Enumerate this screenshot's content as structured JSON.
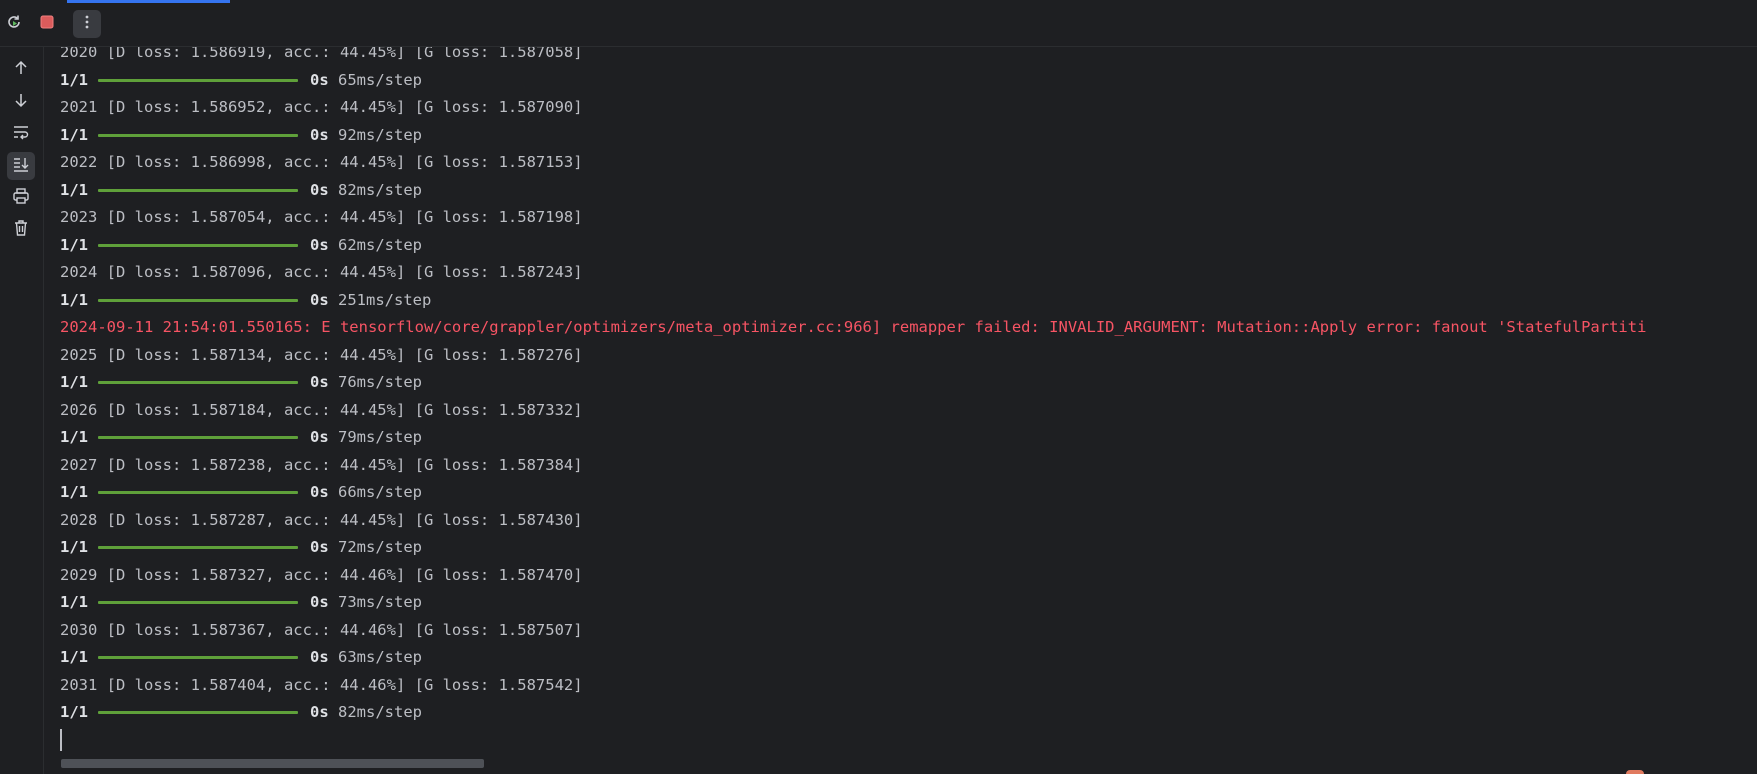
{
  "toolbar": {
    "rerun_icon": "rerun-icon",
    "stop_icon": "stop-icon",
    "more_icon": "more-vertical-icon"
  },
  "sidebar": {
    "items": [
      {
        "name": "scroll-up-icon"
      },
      {
        "name": "scroll-down-icon"
      },
      {
        "name": "soft-wrap-icon"
      },
      {
        "name": "scroll-to-end-icon"
      },
      {
        "name": "print-icon"
      },
      {
        "name": "clear-all-icon"
      }
    ]
  },
  "console": {
    "epochs": [
      {
        "epoch": "2020 [D loss: 1.586919, acc.: 44.45%] [G loss: 1.587058]",
        "progress": "1/1",
        "time_label": "0s",
        "step": "65ms/step",
        "fraction": 1.0
      },
      {
        "epoch": "2021 [D loss: 1.586952, acc.: 44.45%] [G loss: 1.587090]",
        "progress": "1/1",
        "time_label": "0s",
        "step": "92ms/step",
        "fraction": 1.0
      },
      {
        "epoch": "2022 [D loss: 1.586998, acc.: 44.45%] [G loss: 1.587153]",
        "progress": "1/1",
        "time_label": "0s",
        "step": "82ms/step",
        "fraction": 1.0
      },
      {
        "epoch": "2023 [D loss: 1.587054, acc.: 44.45%] [G loss: 1.587198]",
        "progress": "1/1",
        "time_label": "0s",
        "step": "62ms/step",
        "fraction": 1.0
      },
      {
        "epoch": "2024 [D loss: 1.587096, acc.: 44.45%] [G loss: 1.587243]",
        "progress": "1/1",
        "time_label": "0s",
        "step": "251ms/step",
        "fraction": 1.0
      }
    ],
    "error_line": "2024-09-11 21:54:01.550165: E tensorflow/core/grappler/optimizers/meta_optimizer.cc:966] remapper failed: INVALID_ARGUMENT: Mutation::Apply error: fanout 'StatefulPartiti",
    "epochs_after": [
      {
        "epoch": "2025 [D loss: 1.587134, acc.: 44.45%] [G loss: 1.587276]",
        "progress": "1/1",
        "time_label": "0s",
        "step": "76ms/step",
        "fraction": 1.0
      },
      {
        "epoch": "2026 [D loss: 1.587184, acc.: 44.45%] [G loss: 1.587332]",
        "progress": "1/1",
        "time_label": "0s",
        "step": "79ms/step",
        "fraction": 1.0
      },
      {
        "epoch": "2027 [D loss: 1.587238, acc.: 44.45%] [G loss: 1.587384]",
        "progress": "1/1",
        "time_label": "0s",
        "step": "66ms/step",
        "fraction": 1.0
      },
      {
        "epoch": "2028 [D loss: 1.587287, acc.: 44.45%] [G loss: 1.587430]",
        "progress": "1/1",
        "time_label": "0s",
        "step": "72ms/step",
        "fraction": 1.0
      },
      {
        "epoch": "2029 [D loss: 1.587327, acc.: 44.46%] [G loss: 1.587470]",
        "progress": "1/1",
        "time_label": "0s",
        "step": "73ms/step",
        "fraction": 1.0
      },
      {
        "epoch": "2030 [D loss: 1.587367, acc.: 44.46%] [G loss: 1.587507]",
        "progress": "1/1",
        "time_label": "0s",
        "step": "63ms/step",
        "fraction": 1.0
      },
      {
        "epoch": "2031 [D loss: 1.587404, acc.: 44.46%] [G loss: 1.587542]",
        "progress": "1/1",
        "time_label": "0s",
        "step": "82ms/step",
        "fraction": 1.0
      }
    ]
  },
  "colors": {
    "background": "#1e1f22",
    "text": "#bcbec4",
    "error": "#f75464",
    "progress_bar": "#5fa03a",
    "accent": "#3574f0"
  }
}
